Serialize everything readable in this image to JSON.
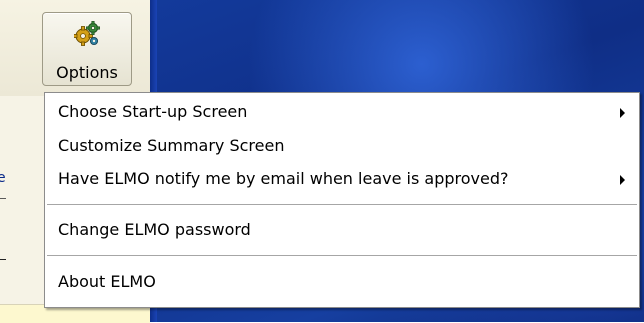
{
  "toolbar": {
    "options_label": "Options",
    "options_icon": "gears-icon"
  },
  "menu": {
    "items": [
      {
        "label": "Choose Start-up Screen",
        "submenu": true
      },
      {
        "label": "Customize Summary Screen",
        "submenu": false
      },
      {
        "label": "Have ELMO notify me by email when leave is approved?",
        "submenu": true
      },
      {
        "label": "Change ELMO password",
        "submenu": false
      },
      {
        "label": "About ELMO",
        "submenu": false
      }
    ]
  },
  "background": {
    "partial_text": "e"
  },
  "colors": {
    "desktop_blue": "#133a9b",
    "panel_cream": "#fdf8cf",
    "menu_background": "#ffffff"
  }
}
